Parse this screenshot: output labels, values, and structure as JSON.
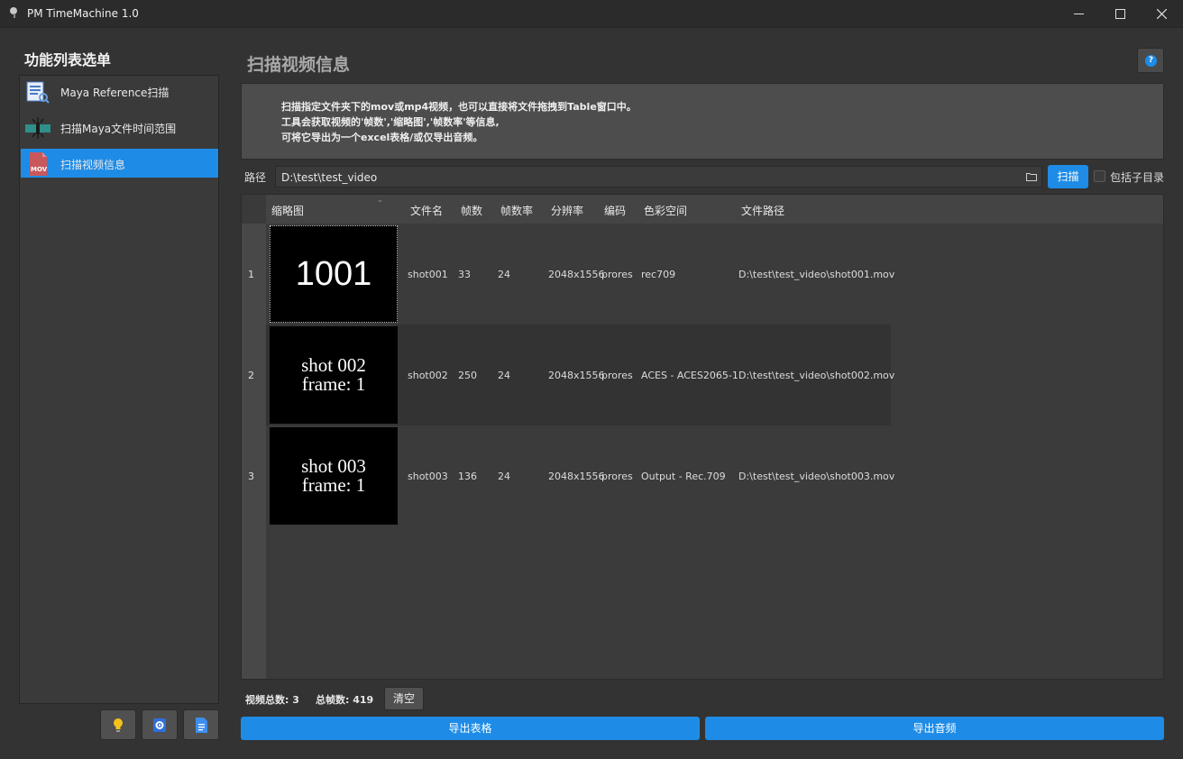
{
  "window": {
    "title": "PM TimeMachine 1.0"
  },
  "sidebar": {
    "title": "功能列表选单",
    "items": [
      {
        "label": "Maya Reference扫描",
        "icon": "maya-reference-icon"
      },
      {
        "label": "扫描Maya文件时间范围",
        "icon": "time-range-icon"
      },
      {
        "label": "扫描视频信息",
        "icon": "mov-file-icon",
        "icon_text": "MOV",
        "active": true
      }
    ],
    "bottom_buttons": [
      "lightbulb-icon",
      "settings-icon",
      "document-icon"
    ]
  },
  "page": {
    "title": "扫描视频信息",
    "help_text": "?"
  },
  "description": [
    "扫描指定文件夹下的mov或mp4视频，也可以直接将文件拖拽到Table窗口中。",
    "工具会获取视频的'帧数','缩略图','帧数率'等信息,",
    "可将它导出为一个excel表格/或仅导出音频。"
  ],
  "path": {
    "label": "路径",
    "value": "D:\\test\\test_video"
  },
  "scan_button": "扫描",
  "include_subdirs": {
    "label": "包括子目录",
    "checked": false
  },
  "table": {
    "sort_indicator": "⌄",
    "columns": [
      "缩略图",
      "文件名",
      "帧数",
      "帧数率",
      "分辨率",
      "编码",
      "色彩空间",
      "文件路径"
    ],
    "rows": [
      {
        "index": "1",
        "thumb_lines": [
          "1001"
        ],
        "filename": "shot001",
        "frames": "33",
        "fps": "24",
        "resolution": "2048x1556",
        "codec": "prores",
        "colorspace": "rec709",
        "path": "D:\\test\\test_video\\shot001.mov"
      },
      {
        "index": "2",
        "thumb_lines": [
          "shot 002",
          "frame: 1"
        ],
        "filename": "shot002",
        "frames": "250",
        "fps": "24",
        "resolution": "2048x1556",
        "codec": "prores",
        "colorspace": "ACES - ACES2065-1",
        "path": "D:\\test\\test_video\\shot002.mov"
      },
      {
        "index": "3",
        "thumb_lines": [
          "shot 003",
          "frame: 1"
        ],
        "filename": "shot003",
        "frames": "136",
        "fps": "24",
        "resolution": "2048x1556",
        "codec": "prores",
        "colorspace": "Output - Rec.709",
        "path": "D:\\test\\test_video\\shot003.mov"
      }
    ]
  },
  "summary": {
    "videos": "视频总数: 3",
    "frames": "总帧数: 419",
    "clear_button": "清空"
  },
  "export": {
    "table_button": "导出表格",
    "audio_button": "导出音频"
  },
  "colors": {
    "accent": "#1e8ce6",
    "background": "#333333",
    "panel": "#3b3b3b"
  }
}
